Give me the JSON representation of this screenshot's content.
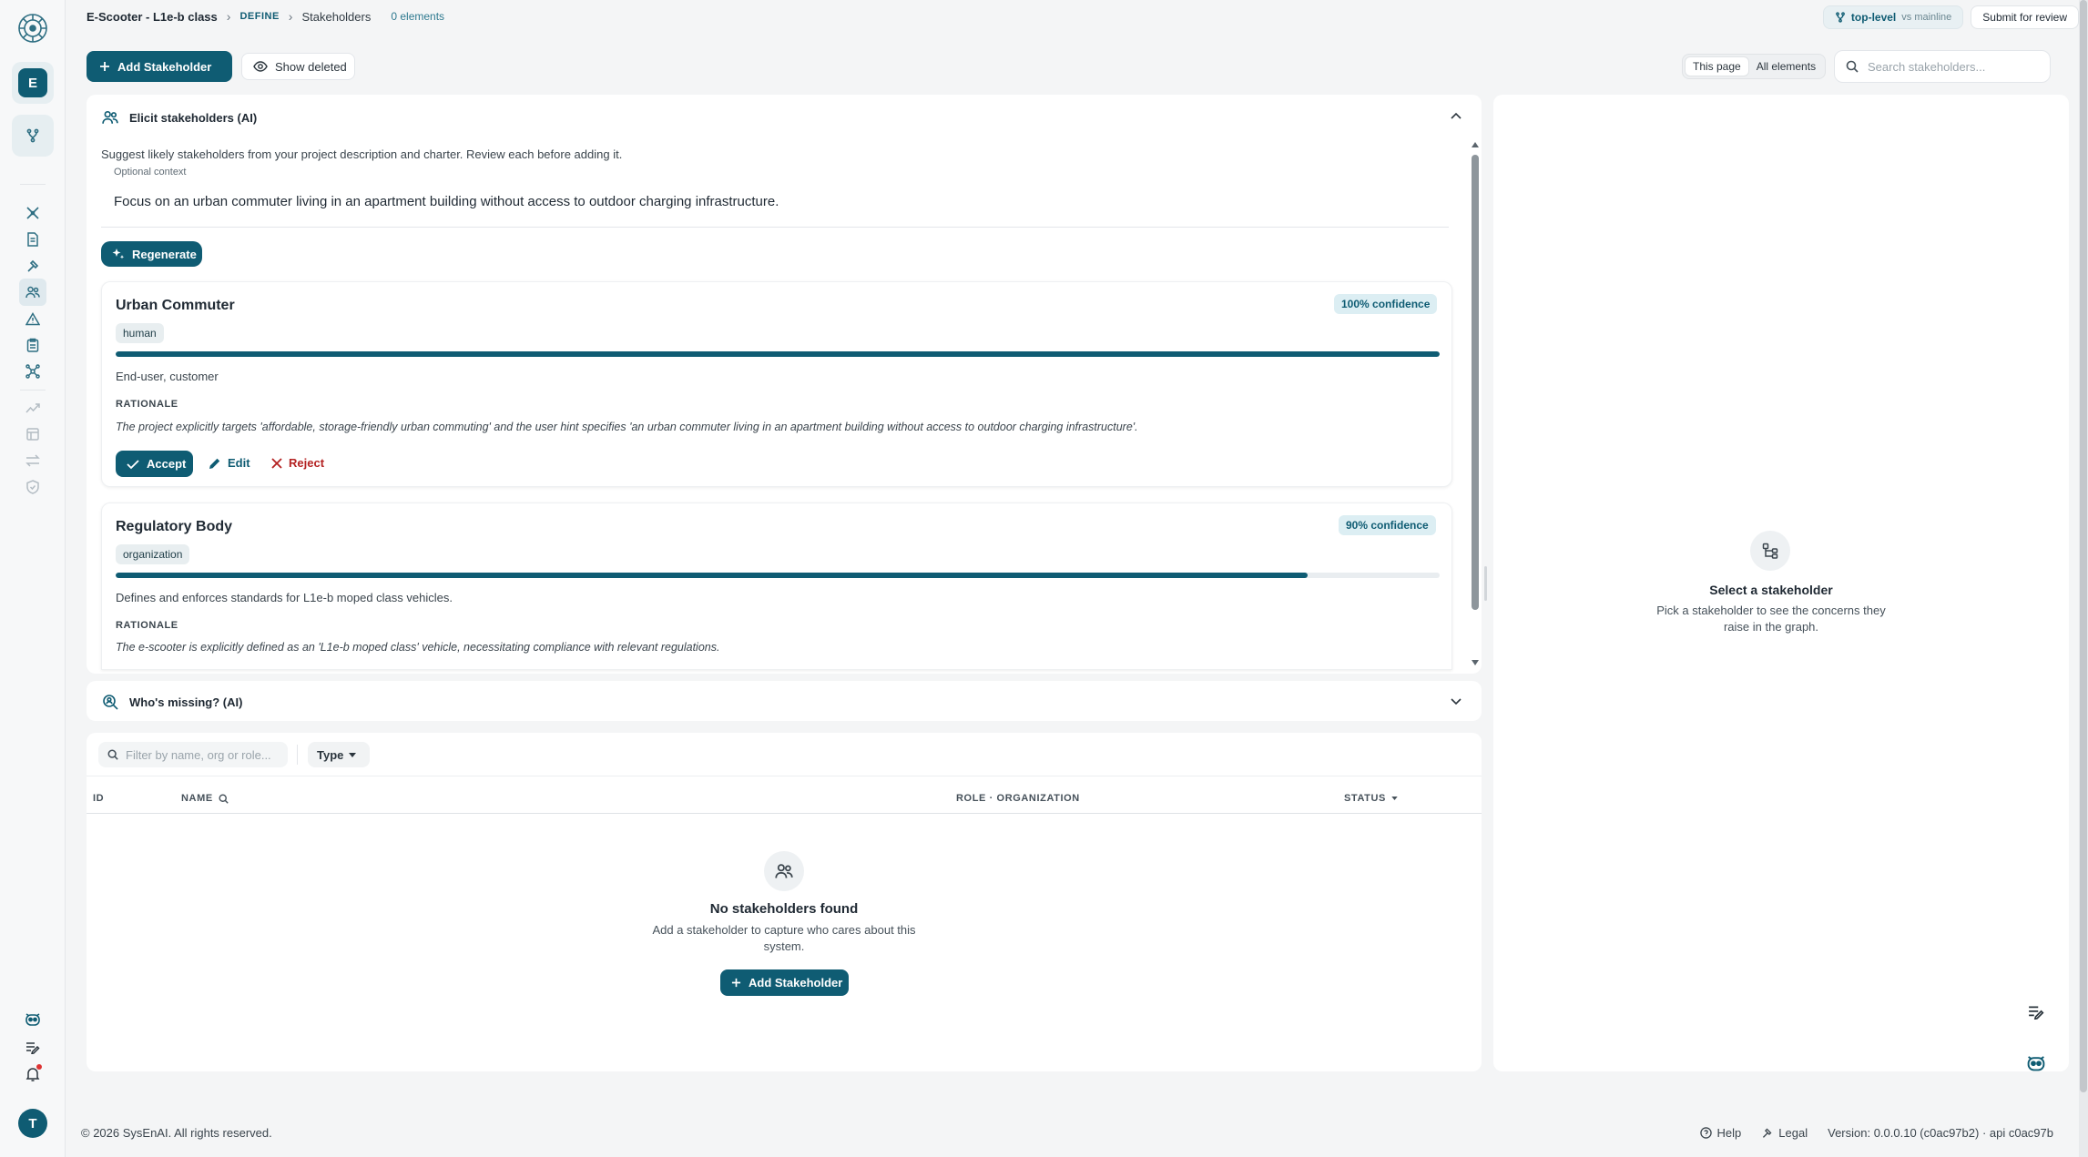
{
  "rail": {
    "workspace_initial": "E",
    "user_initial": "T",
    "icons": [
      "brain-logo-icon",
      "branch-icon",
      "tools-icon",
      "document-icon",
      "hammer-icon",
      "users-icon",
      "warning-icon",
      "clipboard-icon",
      "network-icon",
      "trend-icon",
      "layout-icon",
      "swap-icon",
      "shield-icon",
      "assistant-icon",
      "notes-icon",
      "bell-icon"
    ]
  },
  "breadcrumb": {
    "project": "E-Scooter - L1e-b class",
    "section": "DEFINE",
    "page": "Stakeholders",
    "count": "0 elements"
  },
  "branch": {
    "name": "top-level",
    "compare": "vs mainline"
  },
  "submit_label": "Submit for review",
  "toolbar": {
    "add_label": "Add Stakeholder",
    "show_deleted_label": "Show deleted",
    "scope_this_page": "This page",
    "scope_all": "All elements",
    "search_placeholder": "Search stakeholders..."
  },
  "elicit": {
    "title": "Elicit stakeholders (AI)",
    "description": "Suggest likely stakeholders from your project description and charter. Review each before adding it.",
    "context_label": "Optional context",
    "context_value": "Focus on an urban commuter living in an apartment building without access to outdoor charging infrastructure.",
    "regenerate_label": "Regenerate",
    "rationale_label": "RATIONALE",
    "accept_label": "Accept",
    "edit_label": "Edit",
    "reject_label": "Reject",
    "suggestions": [
      {
        "name": "Urban Commuter",
        "type": "human",
        "confidence_label": "100% confidence",
        "confidence": 100,
        "role": "End-user, customer",
        "rationale": "The project explicitly targets 'affordable, storage-friendly urban commuting' and the user hint specifies 'an urban commuter living in an apartment building without access to outdoor charging infrastructure'."
      },
      {
        "name": "Regulatory Body",
        "type": "organization",
        "confidence_label": "90% confidence",
        "confidence": 90,
        "role": "Defines and enforces standards for L1e-b moped class vehicles.",
        "rationale": "The e-scooter is explicitly defined as an 'L1e-b moped class' vehicle, necessitating compliance with relevant regulations."
      }
    ]
  },
  "missing": {
    "title": "Who's missing? (AI)"
  },
  "table": {
    "filter_placeholder": "Filter by name, org or role...",
    "type_filter_label": "Type",
    "columns": {
      "id": "ID",
      "name": "NAME",
      "role": "ROLE · ORGANIZATION",
      "status": "STATUS"
    },
    "empty_title": "No stakeholders found",
    "empty_desc": "Add a stakeholder to capture who cares about this system.",
    "empty_add_label": "Add Stakeholder"
  },
  "detail": {
    "title": "Select a stakeholder",
    "desc": "Pick a stakeholder to see the concerns they raise in the graph."
  },
  "footer": {
    "copyright": "© 2026 SysEnAI. All rights reserved.",
    "help": "Help",
    "legal": "Legal",
    "version": "Version: 0.0.0.10 (c0ac97b2) · api c0ac97b"
  },
  "colors": {
    "accent": "#0f5c73",
    "danger": "#b42323",
    "background": "#f4f5f6"
  }
}
